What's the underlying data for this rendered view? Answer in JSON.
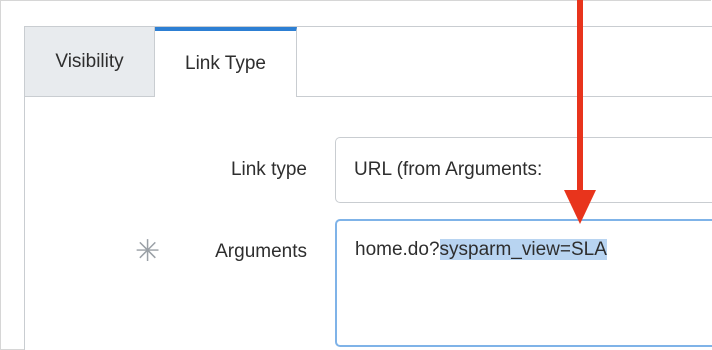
{
  "tabs": [
    {
      "label": "Visibility",
      "active": false
    },
    {
      "label": "Link Type",
      "active": true
    }
  ],
  "form": {
    "link_type": {
      "label": "Link type",
      "value": "URL (from Arguments:"
    },
    "arguments": {
      "label": "Arguments",
      "required_mark": "✳",
      "value_plain": "home.do?",
      "value_selected": "sysparm_view=SLA"
    }
  },
  "colors": {
    "accent": "#2d7fd3",
    "arrow": "#e8341c",
    "selection": "#b8d4f1",
    "focus_border": "#7fb3e8"
  }
}
